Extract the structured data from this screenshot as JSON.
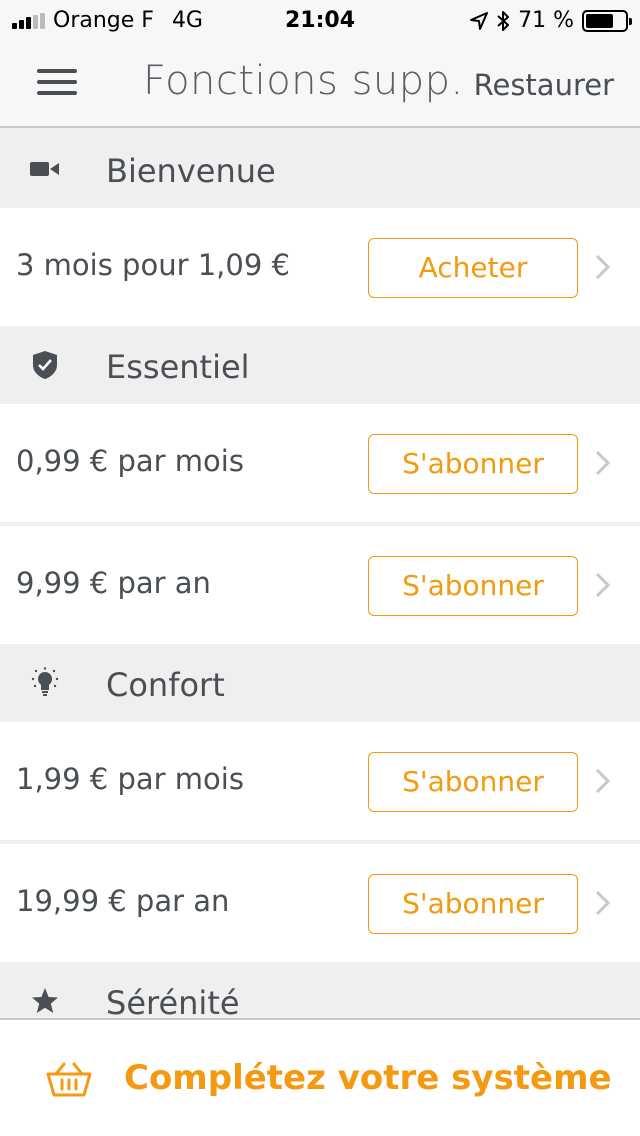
{
  "status_bar": {
    "carrier": "Orange F",
    "network": "4G",
    "time": "21:04",
    "battery_percent": "71 %",
    "battery_level": 0.71,
    "signal_bars_on": 3,
    "signal_bars_total": 5
  },
  "nav": {
    "title": "Fonctions supp.",
    "restore_label": "Restaurer"
  },
  "sections": [
    {
      "title": "Bienvenue",
      "icon": "video-camera-icon",
      "offers": [
        {
          "price": "3 mois pour 1,09 €",
          "button": "Acheter"
        }
      ]
    },
    {
      "title": "Essentiel",
      "icon": "shield-check-icon",
      "offers": [
        {
          "price": "0,99 € par mois",
          "button": "S'abonner"
        },
        {
          "price": "9,99 € par an",
          "button": "S'abonner"
        }
      ]
    },
    {
      "title": "Confort",
      "icon": "lightbulb-icon",
      "offers": [
        {
          "price": "1,99 € par mois",
          "button": "S'abonner"
        },
        {
          "price": "19,99 € par an",
          "button": "S'abonner"
        }
      ]
    },
    {
      "title": "Sérénité",
      "icon": "star-icon",
      "offers": []
    }
  ],
  "bottom_bar": {
    "label": "Complétez votre système",
    "icon": "basket-icon"
  },
  "colors": {
    "accent": "#f39a10",
    "text": "#4a4f55",
    "section_bg": "#efeff0",
    "bar_bg": "#f7f7f7"
  }
}
